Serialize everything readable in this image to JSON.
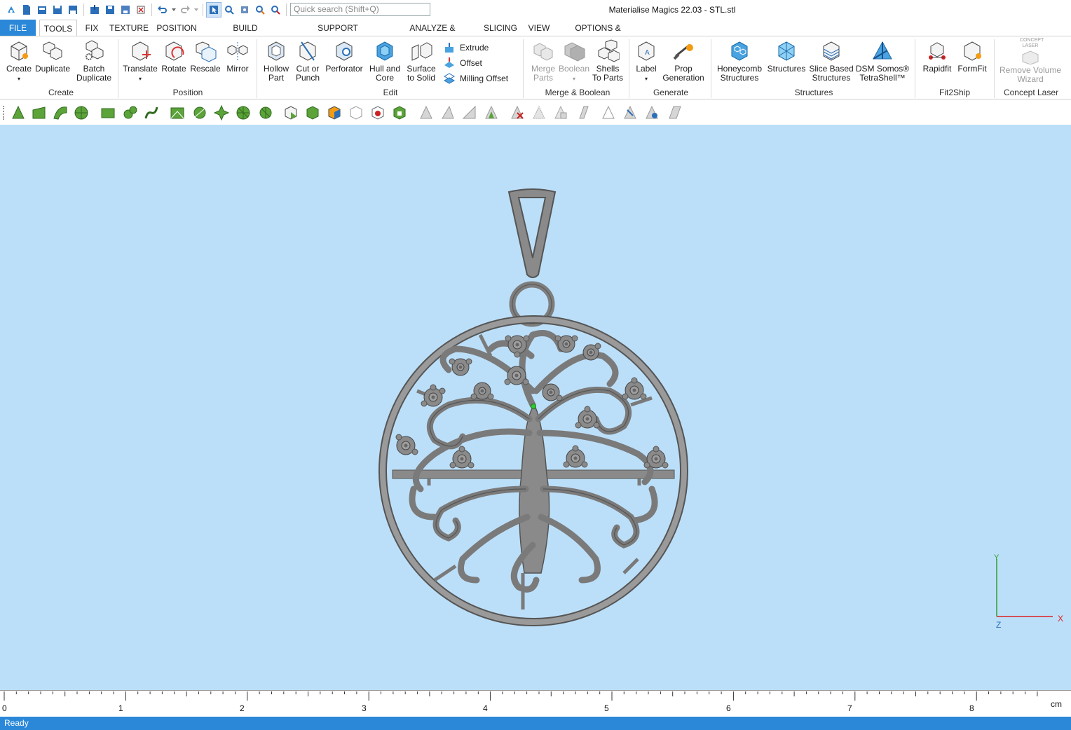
{
  "window": {
    "title": "Materialise Magics 22.03 - STL.stl"
  },
  "quick_search": {
    "placeholder": "Quick search (Shift+Q)"
  },
  "menu_tabs": [
    {
      "label": "FILE"
    },
    {
      "label": "TOOLS"
    },
    {
      "label": "FIX"
    },
    {
      "label": "TEXTURE"
    },
    {
      "label": "POSITION"
    },
    {
      "label": "BUILD PREPARATION"
    },
    {
      "label": "SUPPORT GENERATION"
    },
    {
      "label": "ANALYZE & REPORT"
    },
    {
      "label": "SLICING"
    },
    {
      "label": "VIEW"
    },
    {
      "label": "OPTIONS & HELP"
    }
  ],
  "ribbon": {
    "create": {
      "group": "Create",
      "create": "Create",
      "duplicate": "Duplicate",
      "batch": "Batch",
      "batch2": "Duplicate"
    },
    "position": {
      "group": "Position",
      "translate": "Translate",
      "rotate": "Rotate",
      "rescale": "Rescale",
      "mirror": "Mirror"
    },
    "edit": {
      "group": "Edit",
      "hollow": "Hollow",
      "hollow2": "Part",
      "cut": "Cut or",
      "cut2": "Punch",
      "perforator": "Perforator",
      "hull": "Hull and",
      "hull2": "Core",
      "surface": "Surface",
      "surface2": "to Solid",
      "extrude": "Extrude",
      "offset": "Offset",
      "milling": "Milling Offset"
    },
    "merge": {
      "group": "Merge & Boolean",
      "merge": "Merge",
      "merge2": "Parts",
      "boolean": "Boolean",
      "shells": "Shells",
      "shells2": "To Parts"
    },
    "generate": {
      "group": "Generate",
      "label": "Label",
      "prop": "Prop",
      "prop2": "Generation"
    },
    "structures": {
      "group": "Structures",
      "honeycomb": "Honeycomb",
      "honeycomb2": "Structures",
      "structures": "Structures",
      "slice": "Slice Based",
      "slice2": "Structures",
      "dsm": "DSM Somos®",
      "dsm2": "TetraShell™"
    },
    "fit2ship": {
      "group": "Fit2Ship",
      "rapidfit": "Rapidfit",
      "formfit": "FormFit"
    },
    "concept": {
      "group": "Concept Laser",
      "logo": "CONCEPT LASER",
      "remove": "Remove Volume",
      "remove2": "Wizard"
    }
  },
  "axes": {
    "y": "Y",
    "x": "X",
    "z": "Z"
  },
  "ruler": {
    "ticks": [
      "0",
      "1",
      "2",
      "3",
      "4",
      "5",
      "6",
      "7",
      "8"
    ],
    "unit": "cm"
  },
  "status": {
    "text": "Ready"
  },
  "colors": {
    "accent": "#2b88d8",
    "viewport": "#bcdff9",
    "model": "#8a8a8a"
  }
}
